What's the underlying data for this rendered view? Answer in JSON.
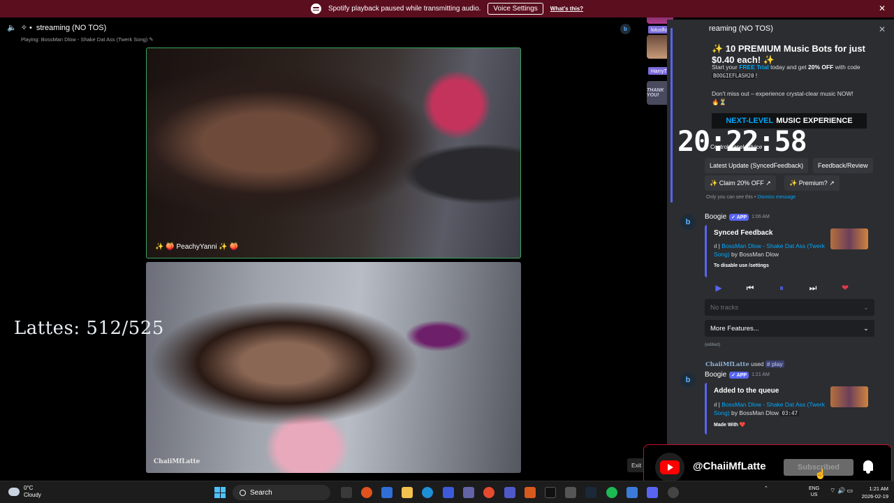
{
  "notice": {
    "message": "Spotify playback paused while transmitting audio.",
    "button": "Voice Settings",
    "link": "What's this?"
  },
  "stage": {
    "title": "streaming (NO TOS)",
    "playing": "Playing: BossMan Dlow - Shake Dat Ass (Twerk Song)"
  },
  "tiles": {
    "a_label": "✨ 🍑 PeachyYanni ✨ 🍑",
    "b_label": "ChaiiMfLatte"
  },
  "lattes": "Lattes: 512/525",
  "members": [
    {
      "name": "lotusflower"
    },
    {
      "name": "HarryTheBritishGuy"
    }
  ],
  "chat": {
    "channel": "reaming (NO TOS)",
    "promo_title": "✨ 10 PREMIUM Music Bots for just $0.40 each! ✨",
    "promo_line1_a": "Start your ",
    "promo_line1_hl": "FREE Trial",
    "promo_line1_b": " today and get ",
    "promo_line1_bold": "20% OFF",
    "promo_line1_c": " with code ",
    "promo_code": "BOOGIEFLASH20",
    "promo_line2": "Don't miss out – experience crystal-clear music NOW! 🔥⏳",
    "banner_a": "NEXT-LEVEL",
    "banner_b": "MUSIC EXPERIENCE",
    "control_panel": "Control Panel   Advice",
    "clock": "20:22:58",
    "btn_latest": "Latest Update (SyncedFeedback)",
    "btn_feedback": "Feedback/Review",
    "btn_claim": "✨ Claim 20% OFF ↗",
    "btn_premium": "✨ Premium? ↗",
    "ephemeral_a": "Only you can see this • ",
    "ephemeral_b": "Dismiss message",
    "msg1": {
      "bot": "Boogie",
      "tag": "✓ APP",
      "time": "1:06 AM",
      "title": "Synced Feedback",
      "song": "BossMan Dlow - Shake Dat Ass (Twerk Song)",
      "by": " by BossMan Dlow",
      "note": "To disable use /settings"
    },
    "no_tracks": "No tracks",
    "more_features": "More Features...",
    "edited": "(edited)",
    "used_user": "ChaiiMfLatte",
    "used_word": " used ",
    "used_cmd": "# play",
    "msg2": {
      "bot": "Boogie",
      "tag": "✓ APP",
      "time": "1:21 AM",
      "title": "Added to the queue",
      "song": "BossMan Dlow - Shake Dat Ass (Twerk Song)",
      "by": " by BossMan Dlow ",
      "duration": "03:47",
      "note": "Made With ❤️"
    }
  },
  "overlay": {
    "exit": "Exit F",
    "handle": "@ChaiiMfLatte",
    "subscribed": "Subscribed"
  },
  "taskbar": {
    "temp": "0°C",
    "condition": "Cloudy",
    "search": "Search",
    "lang1": "ENG",
    "lang2": "US",
    "time": "1:21 AM",
    "date": "2026-02-19"
  },
  "colors": {
    "notice_bg": "#5b0e1e",
    "accent": "#5865f2",
    "link": "#00a8fc",
    "speaking": "#3ba55d",
    "youtube": "#ff0000"
  }
}
